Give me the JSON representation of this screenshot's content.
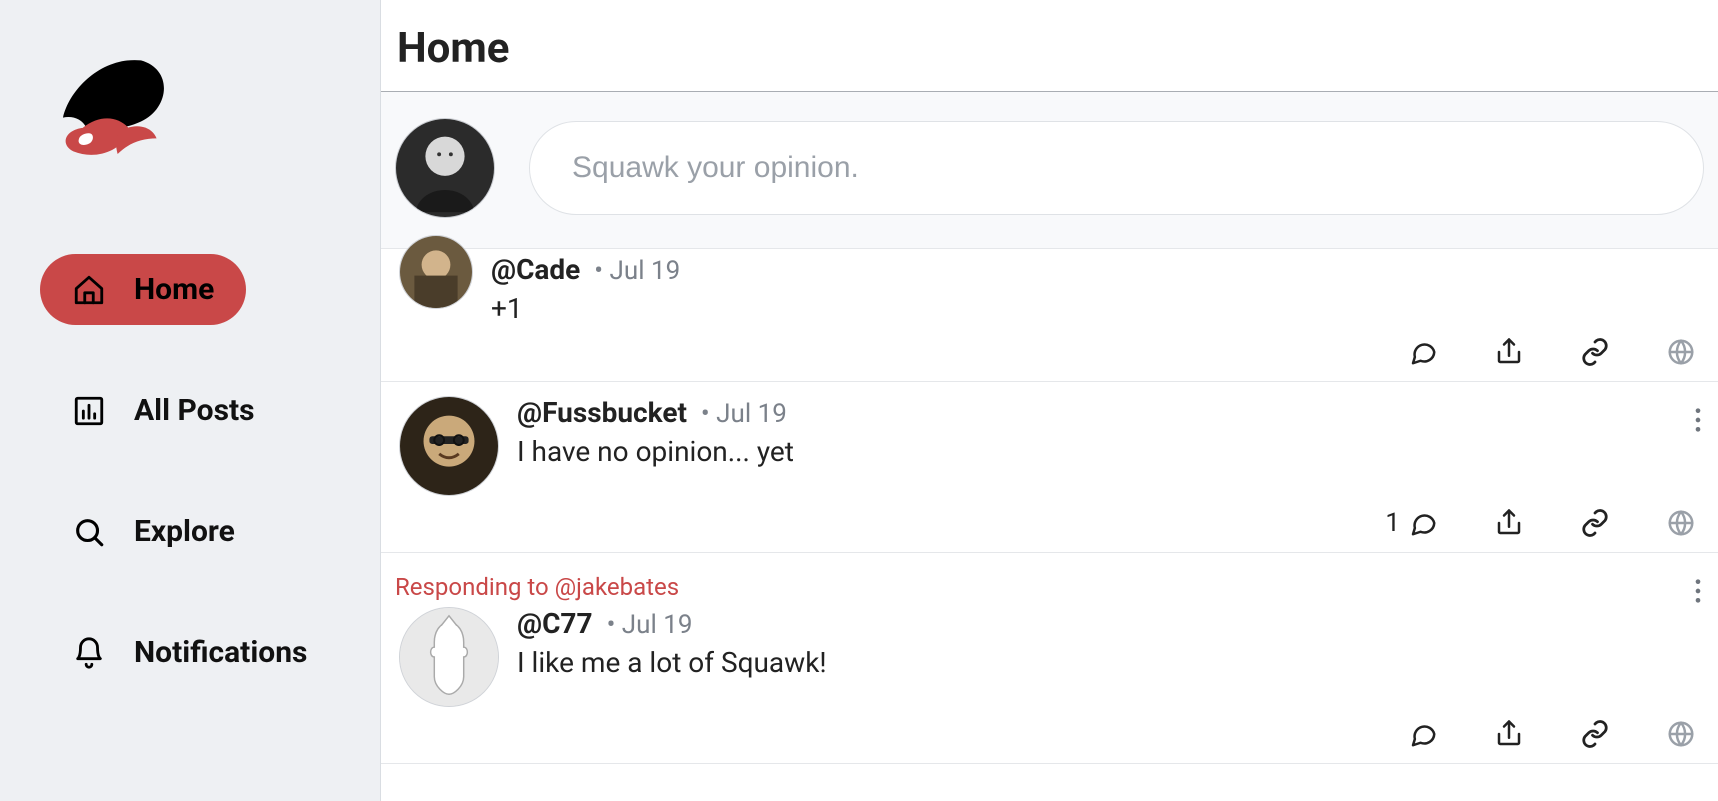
{
  "sidebar": {
    "items": [
      {
        "label": "Home"
      },
      {
        "label": "All Posts"
      },
      {
        "label": "Explore"
      },
      {
        "label": "Notifications"
      }
    ]
  },
  "page": {
    "title": "Home"
  },
  "composer": {
    "placeholder": "Squawk your opinion."
  },
  "posts": [
    {
      "handle": "@Cade",
      "date_prefix": "• ",
      "date": "Jul 19",
      "content": "+1",
      "comment_count": ""
    },
    {
      "handle": "@Fussbucket",
      "date_prefix": "• ",
      "date": "Jul 19",
      "content": "I have no opinion... yet",
      "comment_count": "1"
    },
    {
      "responding_to": "Responding to @jakebates",
      "handle": "@C77",
      "date_prefix": "• ",
      "date": "Jul 19",
      "content": "I like me a lot of Squawk!",
      "comment_count": ""
    }
  ]
}
